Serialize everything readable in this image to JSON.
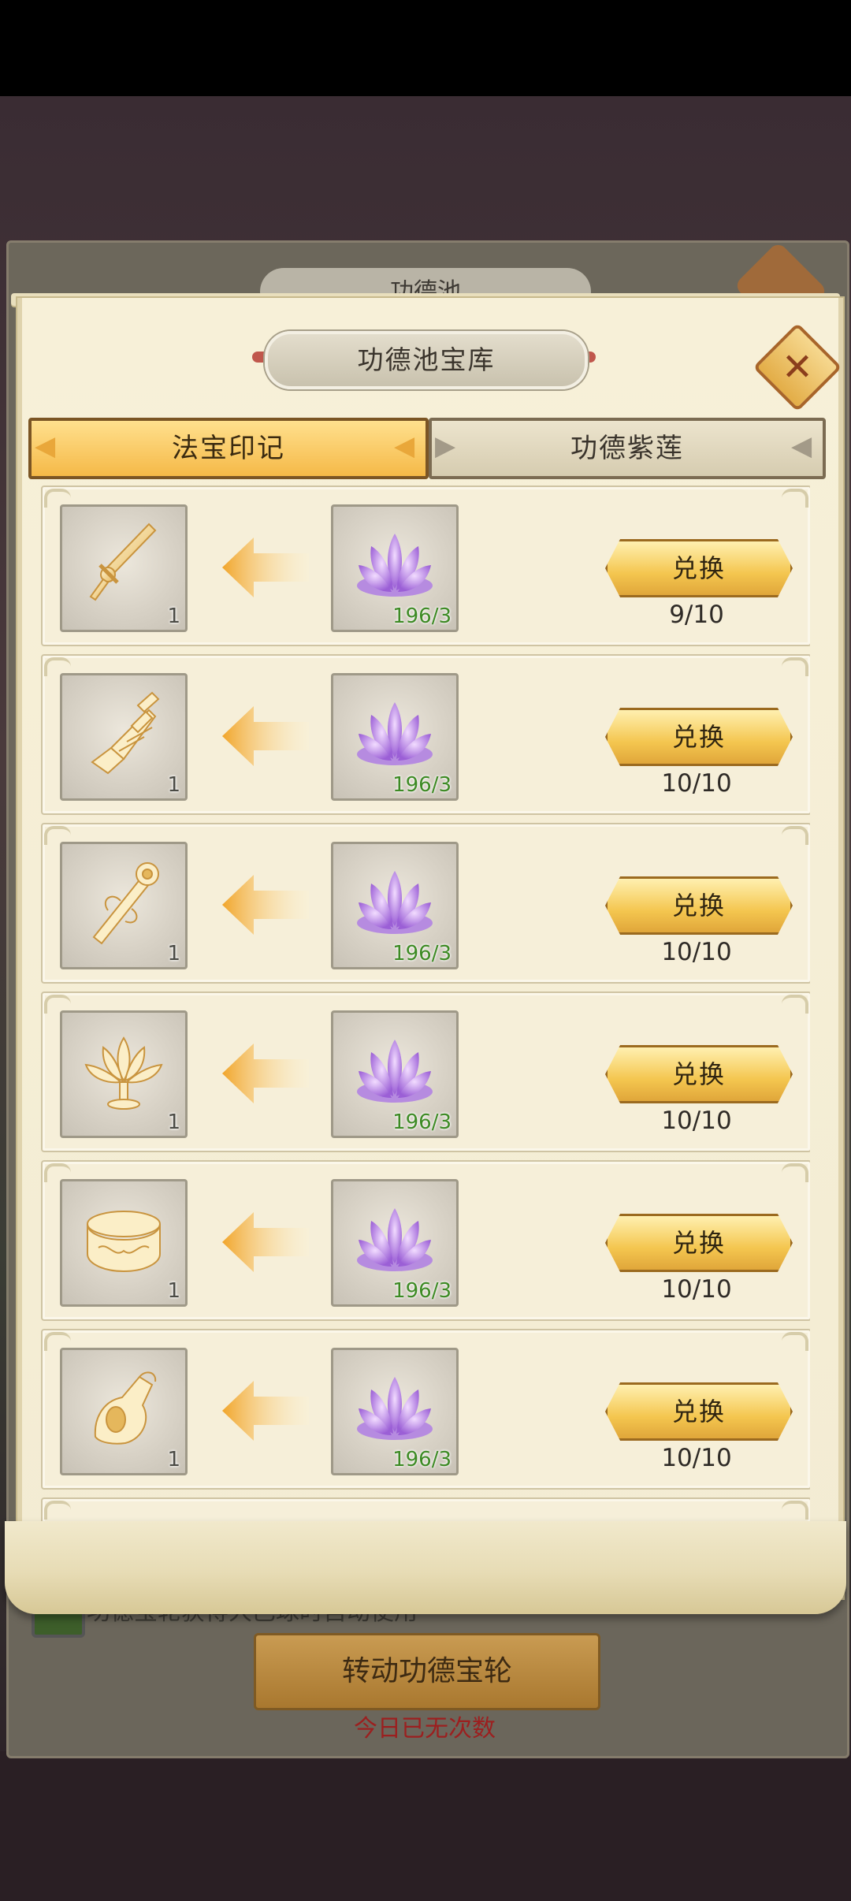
{
  "background": {
    "underlying_title": "功德池",
    "auto_use_text": "功德宝轮获得大巴球时自动使用",
    "spin_button": "转动功德宝轮",
    "no_attempts_text": "今日已无次数"
  },
  "dialog": {
    "title": "功德池宝库",
    "close_icon": "close-icon",
    "tabs": [
      {
        "label": "法宝印记",
        "active": true
      },
      {
        "label": "功德紫莲",
        "active": false
      }
    ]
  },
  "rows": [
    {
      "item_icon": "sword-icon",
      "item_count": "1",
      "cost": "196/3",
      "button": "兑换",
      "progress": "9/10"
    },
    {
      "item_icon": "pagoda-icon",
      "item_count": "1",
      "cost": "196/3",
      "button": "兑换",
      "progress": "10/10"
    },
    {
      "item_icon": "scepter-icon",
      "item_count": "1",
      "cost": "196/3",
      "button": "兑换",
      "progress": "10/10"
    },
    {
      "item_icon": "lotus-lamp-icon",
      "item_count": "1",
      "cost": "196/3",
      "button": "兑换",
      "progress": "10/10"
    },
    {
      "item_icon": "bracelet-icon",
      "item_count": "1",
      "cost": "196/3",
      "button": "兑换",
      "progress": "10/10"
    },
    {
      "item_icon": "gauntlet-icon",
      "item_count": "1",
      "cost": "196/3",
      "button": "兑换",
      "progress": "10/10"
    }
  ],
  "colors": {
    "accent_gold": "#f4c64f",
    "cost_green": "#3d8a24",
    "notice_red": "#9c1f1f"
  }
}
